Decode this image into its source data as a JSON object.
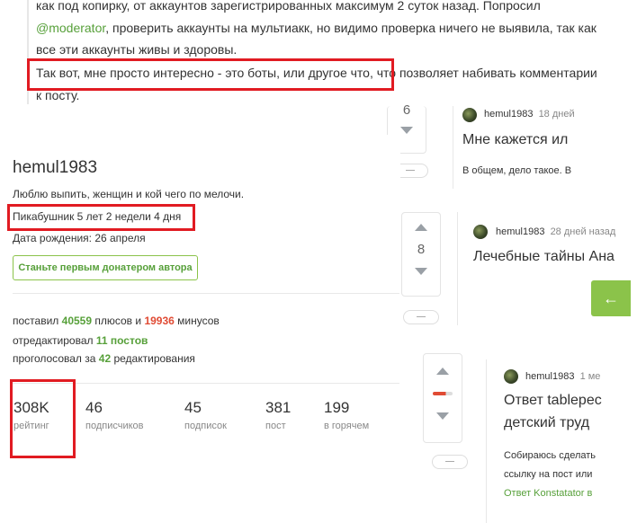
{
  "top_post": {
    "line1": "как под копирку, от аккаунтов зарегистрированных максимум 2 суток назад. Попросил",
    "mention": "@moderator",
    "line2_rest": ", проверить аккаунты на мультиакк, но видимо проверка ничего не выявила, так как",
    "line3": "все эти аккаунты живы и здоровы.",
    "line4": "Так вот, мне просто интересно - это боты, или другое что, что позволяет набивать комментарии",
    "line5": "к посту."
  },
  "profile": {
    "username": "hemul1983",
    "bio": "Люблю выпить, женщин и кой чего по мелочи.",
    "membership": "Пикабушник 5 лет 2 недели 4 дня",
    "birthday": "Дата рождения: 26 апреля",
    "donate_button": "Станьте первым донатером автора",
    "stats": {
      "put_prefix": "поставил",
      "pluses": "40559",
      "pluses_suffix": "плюсов и",
      "minuses": "19936",
      "minuses_suffix": "минусов",
      "edited_prefix": "отредактировал",
      "edited": "11 постов",
      "voted_prefix": "проголосовал за",
      "voted": "42",
      "voted_suffix": "редактирования"
    },
    "numbers": [
      {
        "value": "308K",
        "label": "рейтинг"
      },
      {
        "value": "46",
        "label": "подписчиков"
      },
      {
        "value": "45",
        "label": "подписок"
      },
      {
        "value": "381",
        "label": "пост"
      },
      {
        "value": "199",
        "label": "в горячем"
      }
    ]
  },
  "comments": [
    {
      "rating": "6",
      "author": "hemul1983",
      "date": "18 дней",
      "title": "Мне кажется ил",
      "snippet": "В общем, дело такое. В"
    },
    {
      "rating": "8",
      "author": "hemul1983",
      "date": "28 дней назад",
      "title": "Лечебные тайны Ана",
      "snippet": ""
    },
    {
      "rating": "",
      "author": "hemul1983",
      "date": "1 ме",
      "title": "Ответ tablepec",
      "title2": "детский труд",
      "snippet": "Собираюсь сделать",
      "snippet2": "ссылку на пост или",
      "link": "Ответ Konstatator в"
    }
  ],
  "colors": {
    "accent_green": "#8bc34a",
    "highlight_red": "#e11b22",
    "minus_red": "#e04b34"
  },
  "icons": {
    "back_button": "arrow-left-icon"
  }
}
